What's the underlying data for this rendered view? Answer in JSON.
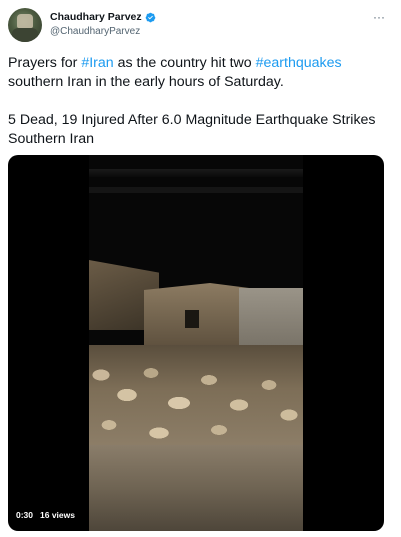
{
  "author": {
    "name": "Chaudhary Parvez",
    "handle": "@ChaudharyParvez",
    "verified_icon": "verified-badge-icon",
    "more_icon": "more-options-icon",
    "more_glyph": "···"
  },
  "tweet": {
    "line1_prefix": "Prayers for ",
    "hashtag_iran": "#Iran",
    "line1_middle": " as the country hit two ",
    "hashtag_earthquakes": "#earthquakes",
    "line1_suffix": " southern Iran in the early hours of Saturday.",
    "line2": "5 Dead, 19 Injured After 6.0 Magnitude Earthquake Strikes Southern Iran"
  },
  "video": {
    "duration": "0:30",
    "views": "16 views"
  },
  "colors": {
    "link": "#1d9bf0",
    "verified": "#1d9bf0",
    "secondary_text": "#536471"
  }
}
